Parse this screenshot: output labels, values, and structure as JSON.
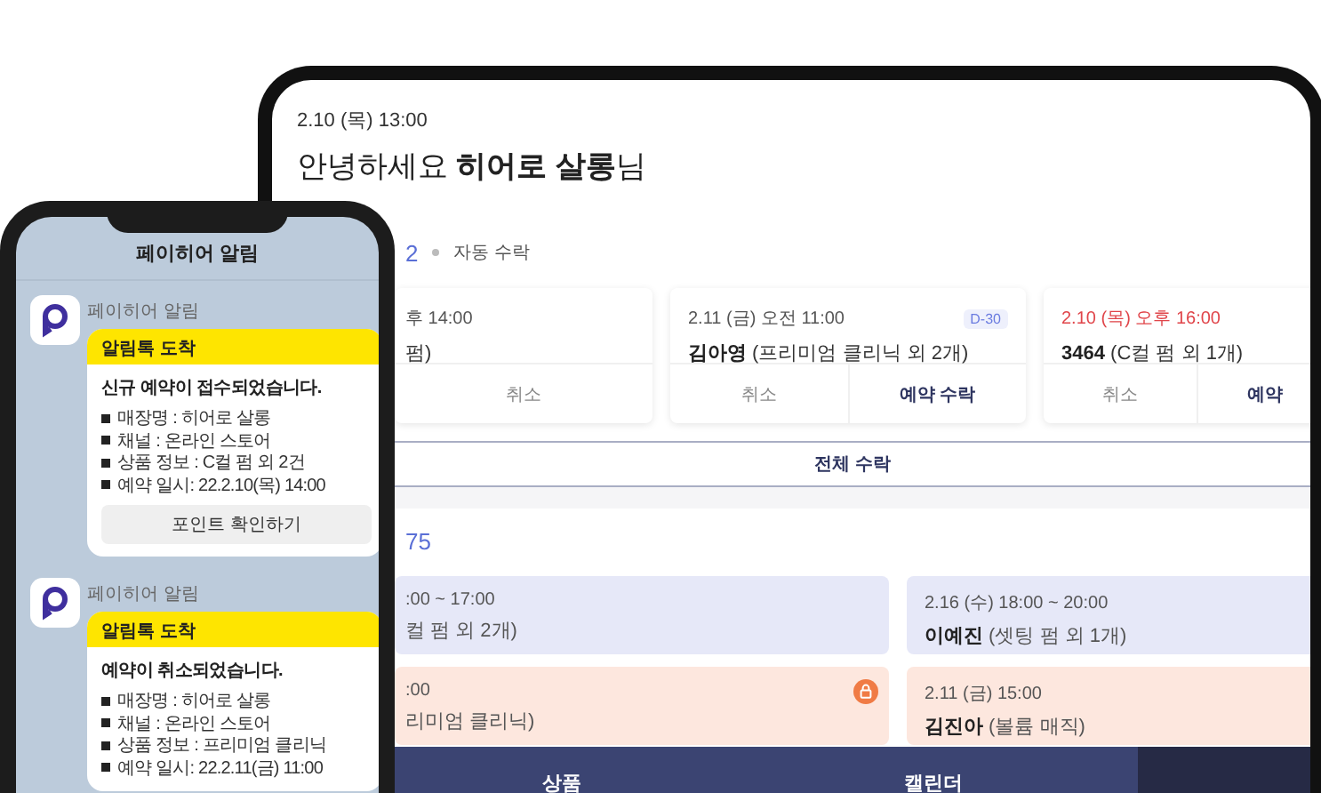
{
  "tablet": {
    "datetime": "2.10 (목) 13:00",
    "greeting": "안녕하세요 **히어로 살롱**님",
    "request_count": "2",
    "auto_accept": "자동 수락",
    "requests": [
      {
        "date": "후 14:00",
        "customer": "펌)",
        "urgent": false,
        "buttons": [
          {
            "label": "취소",
            "kind": "cancel"
          }
        ]
      },
      {
        "date": "2.11 (금) 오전 11:00",
        "customer": "**김아영** (프리미엄 클리닉 외 2개)",
        "urgent": false,
        "badge": "D-30",
        "buttons": [
          {
            "label": "취소",
            "kind": "cancel"
          },
          {
            "label": "예약 수락",
            "kind": "accept"
          }
        ]
      },
      {
        "date": "2.10 (목) 오후 16:00",
        "customer": "**3464** (C컬 펌 외 1개)",
        "urgent": true,
        "buttons": [
          {
            "label": "취소",
            "kind": "cancel"
          },
          {
            "label": "예약",
            "kind": "accept"
          }
        ]
      }
    ],
    "accept_all": "전체 수락",
    "schedule_count": "75",
    "schedule": [
      {
        "time": ":00 ~ 17:00",
        "customer": "컬 펌 외 2개)",
        "kind": "confirmed",
        "locked": false
      },
      {
        "time": "2.16 (수) 18:00 ~ 20:00",
        "customer": "**이예진** (셋팅 펌 외 1개)",
        "kind": "confirmed",
        "locked": false
      },
      {
        "time": ":00",
        "customer": "리미엄 클리닉)",
        "kind": "pending",
        "locked": true
      },
      {
        "time": "2.11 (금) 15:00",
        "customer": "**김진아** (볼륨 매직)",
        "kind": "pending",
        "locked": false
      }
    ],
    "nav_tabs": [
      {
        "label": "상품",
        "selected": false
      },
      {
        "label": "캘린더",
        "selected": false
      },
      {
        "selected": true
      }
    ]
  },
  "phone": {
    "title": "페이히어 알림",
    "messages": [
      {
        "sender": "페이히어 알림",
        "header": "알림톡 도착",
        "title": "신규 예약이 접수되었습니다.",
        "items": [
          "매장명 : 히어로 살롱",
          "채널 : 온라인 스토어",
          "상품 정보 : C컬 펌 외 2건",
          "예약 일시: 22.2.10(목) 14:00"
        ],
        "button": "포인트 확인하기"
      },
      {
        "sender": "페이히어 알림",
        "header": "알림톡 도착",
        "title": "예약이 취소되었습니다.",
        "items": [
          "매장명 : 히어로 살롱",
          "채널 : 온라인 스토어",
          "상품 정보 : 프리미엄 클리닉",
          "예약 일시: 22.2.11(금) 11:00"
        ]
      }
    ]
  }
}
